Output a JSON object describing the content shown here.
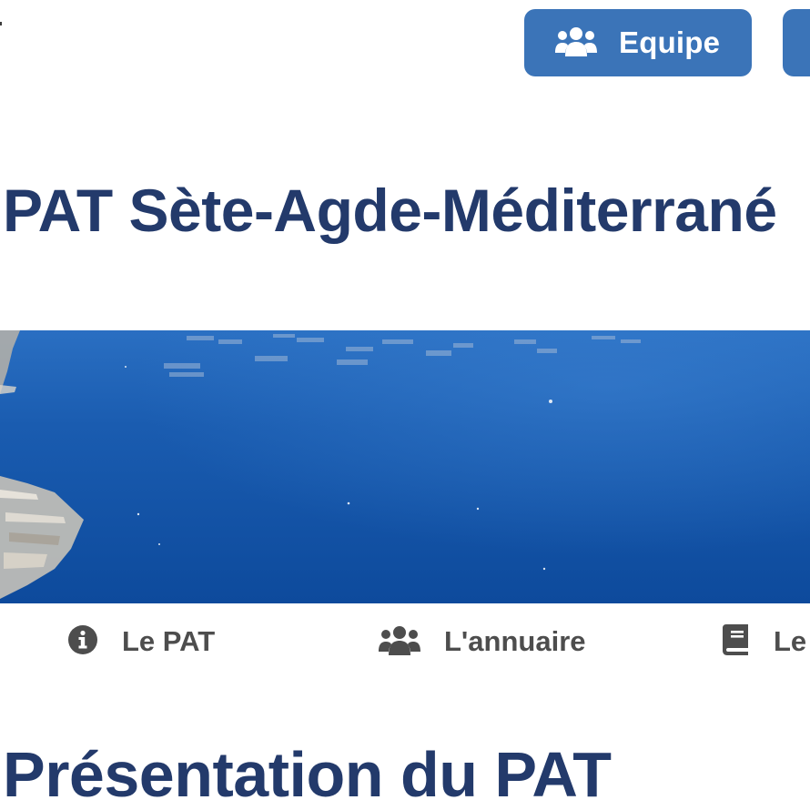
{
  "header": {
    "buttons": [
      {
        "label": "Equipe",
        "icon": "users-icon"
      },
      {
        "label": "",
        "icon": ""
      }
    ]
  },
  "site_title": "PAT Sète-Agde-Méditerrané",
  "tabs": [
    {
      "label": "Le PAT",
      "icon": "info-circle-icon"
    },
    {
      "label": "L'annuaire",
      "icon": "users-icon"
    },
    {
      "label": "Le",
      "icon": "book-icon"
    }
  ],
  "section": {
    "title": "Présentation du PAT"
  },
  "colors": {
    "accent": "#3b74b8",
    "title": "#233a6b",
    "tab_text": "#4d4d4d",
    "sea": "#1a5cb0"
  }
}
